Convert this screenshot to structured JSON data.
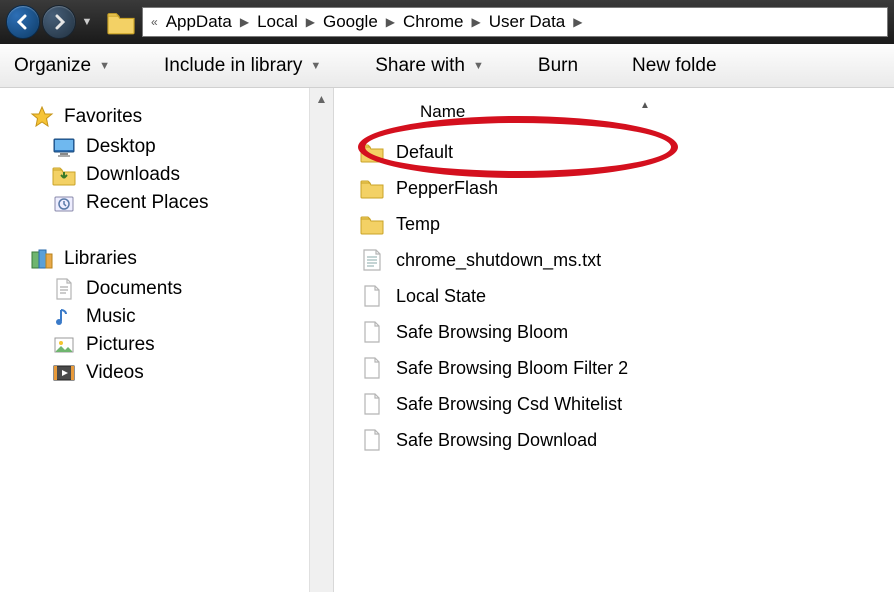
{
  "breadcrumb": {
    "overflow": "«",
    "items": [
      "AppData",
      "Local",
      "Google",
      "Chrome",
      "User Data"
    ]
  },
  "toolbar": {
    "organize": "Organize",
    "include": "Include in library",
    "share": "Share with",
    "burn": "Burn",
    "newfolder": "New folde"
  },
  "sidebar": {
    "favorites": {
      "label": "Favorites",
      "items": [
        {
          "icon": "desktop",
          "label": "Desktop"
        },
        {
          "icon": "downloads",
          "label": "Downloads"
        },
        {
          "icon": "recent",
          "label": "Recent Places"
        }
      ]
    },
    "libraries": {
      "label": "Libraries",
      "items": [
        {
          "icon": "documents",
          "label": "Documents"
        },
        {
          "icon": "music",
          "label": "Music"
        },
        {
          "icon": "pictures",
          "label": "Pictures"
        },
        {
          "icon": "videos",
          "label": "Videos"
        }
      ]
    }
  },
  "content": {
    "column_header": "Name",
    "items": [
      {
        "type": "folder",
        "name": "Default",
        "highlighted": true
      },
      {
        "type": "folder",
        "name": "PepperFlash"
      },
      {
        "type": "folder",
        "name": "Temp"
      },
      {
        "type": "txt",
        "name": "chrome_shutdown_ms.txt"
      },
      {
        "type": "file",
        "name": "Local State"
      },
      {
        "type": "file",
        "name": "Safe Browsing Bloom"
      },
      {
        "type": "file",
        "name": "Safe Browsing Bloom Filter 2"
      },
      {
        "type": "file",
        "name": "Safe Browsing Csd Whitelist"
      },
      {
        "type": "file",
        "name": "Safe Browsing Download"
      }
    ]
  }
}
